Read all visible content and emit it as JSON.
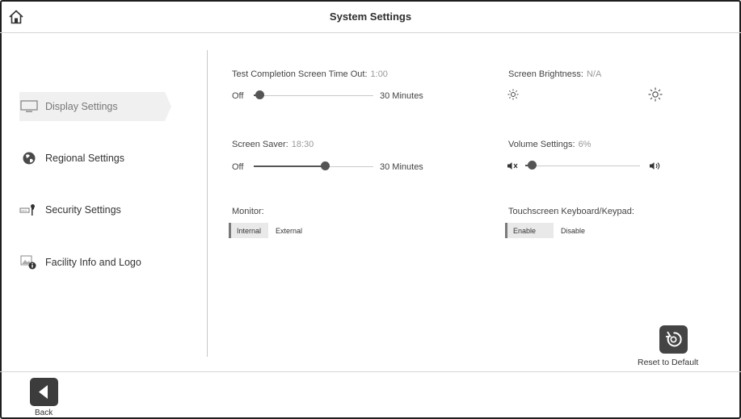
{
  "header": {
    "title": "System Settings",
    "home_icon": "home-icon"
  },
  "sidebar": {
    "items": [
      {
        "label": "Display Settings",
        "icon": "monitor-icon",
        "active": true
      },
      {
        "label": "Regional Settings",
        "icon": "globe-icon",
        "active": false
      },
      {
        "label": "Security Settings",
        "icon": "key-icon",
        "active": false
      },
      {
        "label": "Facility Info and Logo",
        "icon": "image-info-icon",
        "active": false
      }
    ]
  },
  "settings": {
    "timeout": {
      "label": "Test Completion Screen Time Out:",
      "value": "1:00",
      "min_label": "Off",
      "max_label": "30 Minutes",
      "level": 0.05
    },
    "screen_saver": {
      "label": "Screen Saver:",
      "value": "18:30",
      "min_label": "Off",
      "max_label": "30 Minutes",
      "level": 0.6
    },
    "monitor": {
      "label": "Monitor:",
      "options": [
        "Internal",
        "External"
      ],
      "selected": "Internal"
    },
    "brightness": {
      "label": "Screen Brightness:",
      "value": "N/A"
    },
    "volume": {
      "label": "Volume Settings:",
      "value": "6%",
      "level": 0.06
    },
    "keyboard": {
      "label": "Touchscreen Keyboard/Keypad:",
      "options": [
        "Enable",
        "Disable"
      ],
      "selected": "Enable"
    }
  },
  "reset": {
    "label": "Reset to Default"
  },
  "footer": {
    "back_label": "Back"
  },
  "colors": {
    "accent": "#555555",
    "frame": "#1e1e1e"
  }
}
